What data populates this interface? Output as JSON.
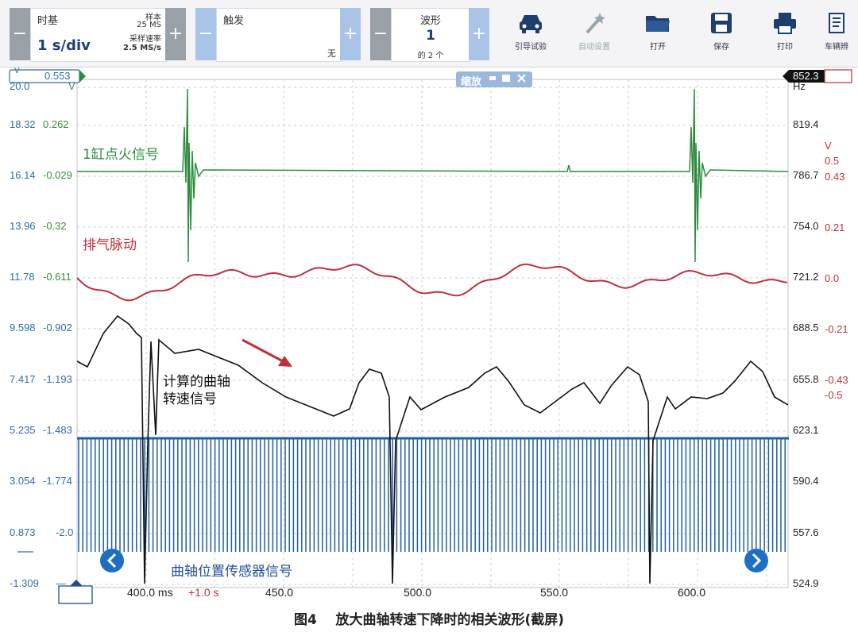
{
  "toolbar": {
    "timebase": {
      "title": "时基",
      "value": "1 s/div",
      "samples_label": "样本",
      "samples_value": "25 MS",
      "rate_label": "采样速率",
      "rate_value": "2.5 MS/s"
    },
    "trigger": {
      "title": "触发",
      "mode": "无"
    },
    "waveform": {
      "title": "波形",
      "value": "1",
      "count": "的 2 个"
    },
    "minus": "−",
    "plus": "+",
    "buttons": [
      {
        "label": "引导试验",
        "icon": "car-icon"
      },
      {
        "label": "自动设置",
        "icon": "wand-icon",
        "disabled": true
      },
      {
        "label": "打开",
        "icon": "folder-icon"
      },
      {
        "label": "保存",
        "icon": "save-icon"
      },
      {
        "label": "打印",
        "icon": "printer-icon"
      },
      {
        "label": "车辆辨",
        "icon": "vehicle-id-icon"
      }
    ]
  },
  "zoom_pill": {
    "label": "缩放"
  },
  "left_marker": {
    "unit": "V",
    "value": "0.553"
  },
  "right_marker": {
    "value": "852.3"
  },
  "left_axis_outer": {
    "labels": [
      "20.0",
      "18.32",
      "16.14",
      "13.96",
      "11.78",
      "9.598",
      "7.417",
      "5.235",
      "3.054",
      "0.873",
      "-1.309"
    ]
  },
  "left_axis_inner": {
    "labels": [
      "V",
      "0.262",
      "-0.029",
      "-0.32",
      "-0.611",
      "-0.902",
      "-1.193",
      "-1.483",
      "-1.774",
      "-2.0",
      "—"
    ]
  },
  "right_axis_hz": {
    "labels": [
      "Hz",
      "819.4",
      "786.7",
      "754.0",
      "721.2",
      "688.5",
      "655.8",
      "623.1",
      "590.4",
      "557.6",
      "524.9"
    ]
  },
  "right_axis_v": {
    "labels": [
      "V",
      "0.5",
      "0.43",
      "0.21",
      "0.0",
      "-0.21",
      "-0.43",
      "-0.5"
    ]
  },
  "x_axis": {
    "labels": [
      "400.0 ms",
      "+1.0 s",
      "450.0",
      "500.0",
      "550.0",
      "600.0"
    ]
  },
  "annotations": {
    "ignition": "1缸点火信号",
    "exhaust": "排气脉动",
    "rpm_line1": "计算的曲轴",
    "rpm_line2": "转速信号",
    "crank": "曲轴位置传感器信号"
  },
  "caption": {
    "fig": "图4",
    "text": "放大曲轴转速下降时的相关波形(截屏)"
  },
  "colors": {
    "green": "#2e8b3e",
    "red": "#c0303a",
    "black": "#111111",
    "blue": "#1f5fa8",
    "grid": "#c9ccd2"
  }
}
